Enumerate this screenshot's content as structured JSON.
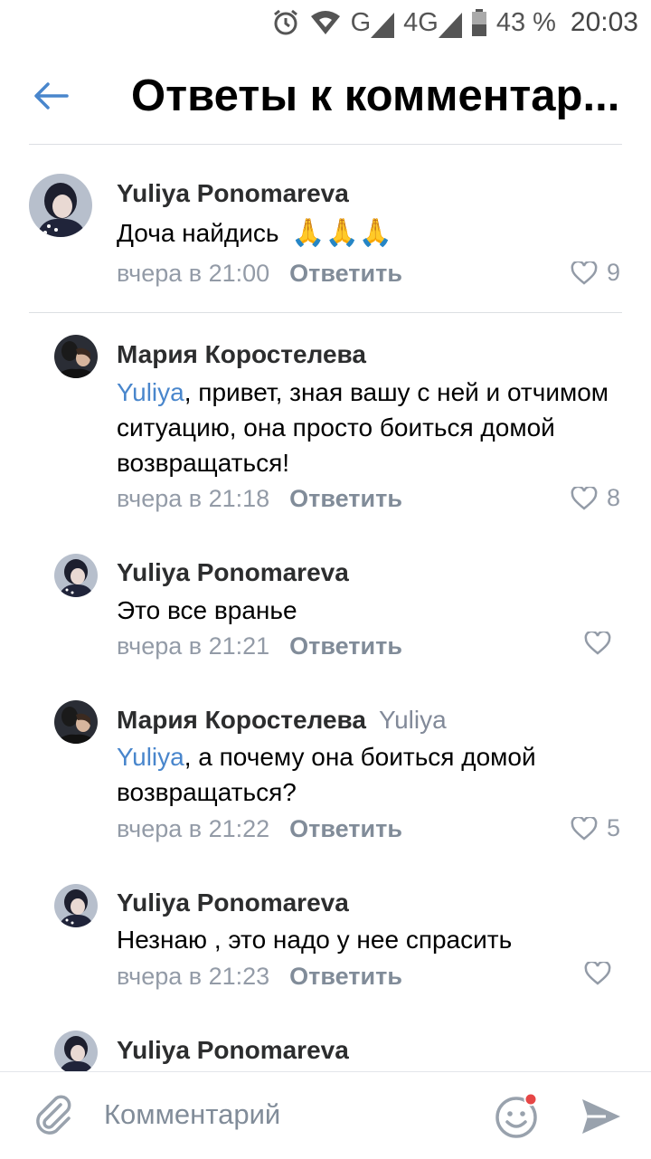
{
  "status_bar": {
    "network": "G",
    "network2": "4G",
    "battery": "43 %",
    "time": "20:03"
  },
  "header": {
    "title": "Ответы к комментар..."
  },
  "comments": [
    {
      "author": "Yuliya Ponomareva",
      "text": "Доча найдись",
      "emoji": "🙏🙏🙏",
      "time": "вчера в 21:00",
      "reply_label": "Ответить",
      "likes": "9"
    },
    {
      "author": "Мария Коростелева",
      "mention": "Yuliya",
      "text": ", привет, зная вашу с ней и отчимом ситуацию, она просто боиться домой возвращаться!",
      "time": "вчера в 21:18",
      "reply_label": "Ответить",
      "likes": "8"
    },
    {
      "author": "Yuliya Ponomareva",
      "text": "Это все вранье",
      "time": "вчера в 21:21",
      "reply_label": "Ответить",
      "likes": ""
    },
    {
      "author": "Мария Коростелева",
      "reply_to": "Yuliya",
      "mention": "Yuliya",
      "text": ", а почему она боиться домой возвращаться?",
      "time": "вчера в 21:22",
      "reply_label": "Ответить",
      "likes": "5"
    },
    {
      "author": "Yuliya Ponomareva",
      "text": "Незнаю , это надо у нее спрасить",
      "time": "вчера в 21:23",
      "reply_label": "Ответить",
      "likes": ""
    },
    {
      "author": "Yuliya Ponomareva"
    }
  ],
  "composer": {
    "placeholder": "Комментарий"
  },
  "colors": {
    "accent": "#4986cc",
    "secondary_text": "#939ba7",
    "notification_dot": "#e64646"
  },
  "icons": [
    "back-arrow-icon",
    "alarm-icon",
    "wifi-icon",
    "signal-icon",
    "battery-icon",
    "heart-icon",
    "attach-icon",
    "emoji-icon",
    "send-icon"
  ]
}
